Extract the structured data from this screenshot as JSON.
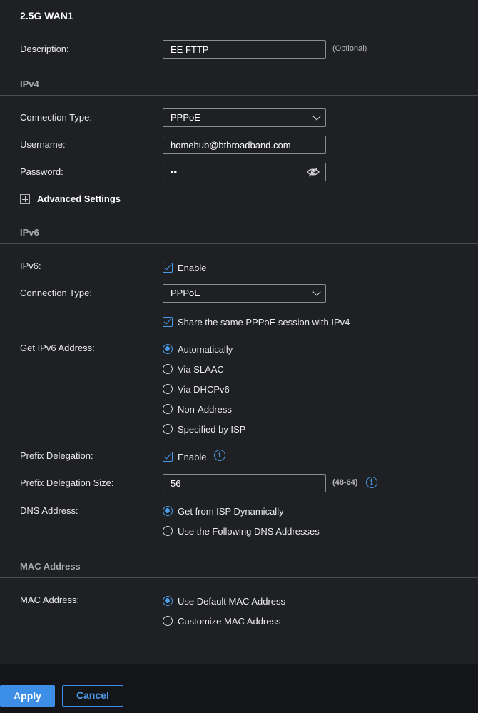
{
  "header": {
    "title": "2.5G WAN1"
  },
  "description": {
    "label": "Description:",
    "value": "EE FTTP",
    "hint": "(Optional)"
  },
  "ipv4": {
    "section": "IPv4",
    "connection_type_label": "Connection Type:",
    "connection_type_value": "PPPoE",
    "username_label": "Username:",
    "username_value": "homehub@btbroadband.com",
    "password_label": "Password:",
    "password_value": "••",
    "advanced_label": "Advanced Settings"
  },
  "ipv6": {
    "section": "IPv6",
    "ipv6_label": "IPv6:",
    "enable_label": "Enable",
    "connection_type_label": "Connection Type:",
    "connection_type_value": "PPPoE",
    "share_session_label": "Share the same PPPoE session with IPv4",
    "get_address_label": "Get IPv6 Address:",
    "address_options": [
      "Automatically",
      "Via SLAAC",
      "Via DHCPv6",
      "Non-Address",
      "Specified by ISP"
    ],
    "prefix_delegation_label": "Prefix Delegation:",
    "prefix_enable_label": "Enable",
    "prefix_size_label": "Prefix Delegation Size:",
    "prefix_size_value": "56",
    "prefix_size_hint": "(48-64)",
    "dns_label": "DNS Address:",
    "dns_options": [
      "Get from ISP Dynamically",
      "Use the Following DNS Addresses"
    ]
  },
  "mac": {
    "section": "MAC Address",
    "label": "MAC Address:",
    "options": [
      "Use Default MAC Address",
      "Customize MAC Address"
    ]
  },
  "footer": {
    "apply_label": "Apply",
    "cancel_label": "Cancel"
  },
  "colors": {
    "accent": "#3d8ee6",
    "background": "#1f2023",
    "footer": "#141518"
  },
  "icons": {
    "info": "info-icon",
    "eye": "eye-slash-icon",
    "plus": "plus-square-icon",
    "chevron": "chevron-down-icon"
  },
  "info_glyph": "i"
}
